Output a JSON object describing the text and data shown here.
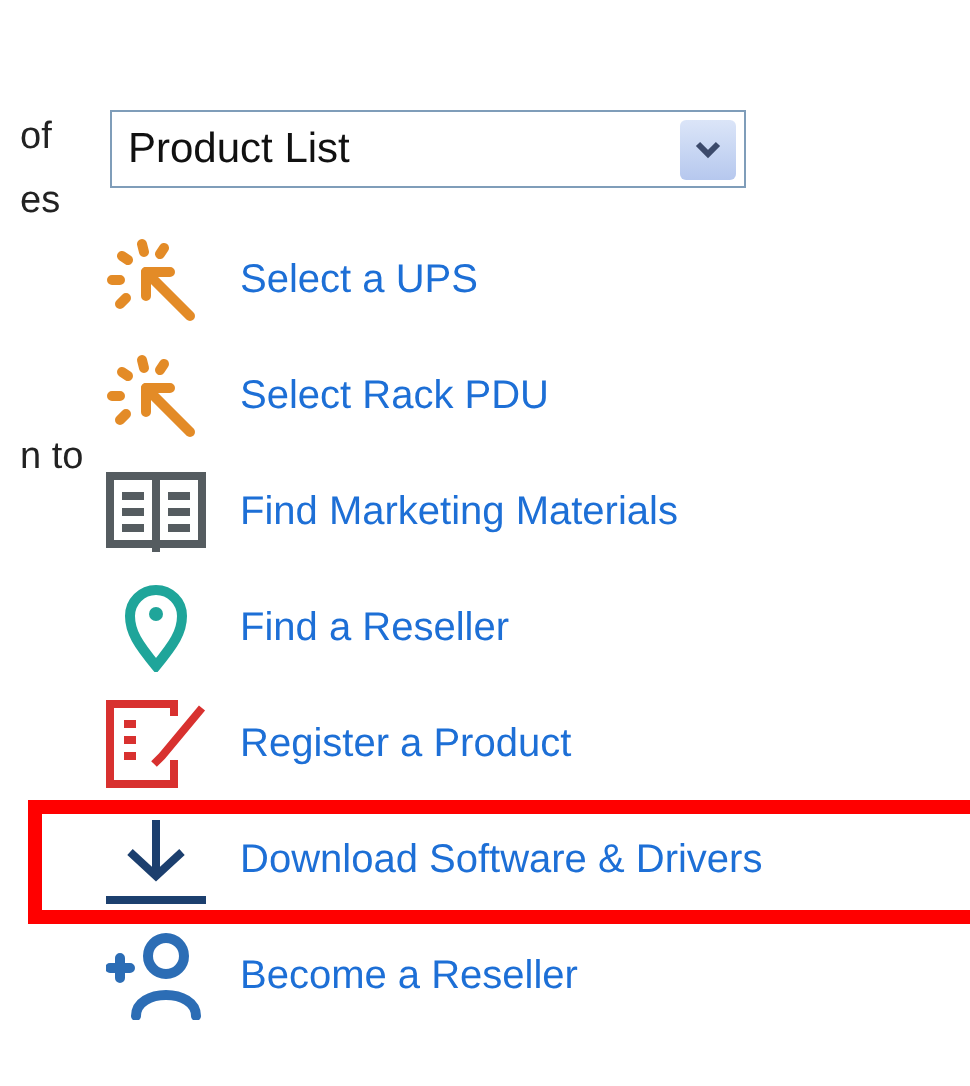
{
  "side_labels": [
    "of",
    "es",
    "n to"
  ],
  "product_select": {
    "value": "Product List"
  },
  "links": [
    {
      "label": "Select a UPS",
      "kind": "spark",
      "highlighted": false
    },
    {
      "label": "Select Rack PDU",
      "kind": "spark",
      "highlighted": false
    },
    {
      "label": "Find Marketing Materials",
      "kind": "book",
      "highlighted": false
    },
    {
      "label": "Find a Reseller",
      "kind": "pin",
      "highlighted": false
    },
    {
      "label": "Register a Product",
      "kind": "form",
      "highlighted": false
    },
    {
      "label": "Download Software & Drivers",
      "kind": "download",
      "highlighted": true
    },
    {
      "label": "Become a Reseller",
      "kind": "adduser",
      "highlighted": false
    }
  ]
}
